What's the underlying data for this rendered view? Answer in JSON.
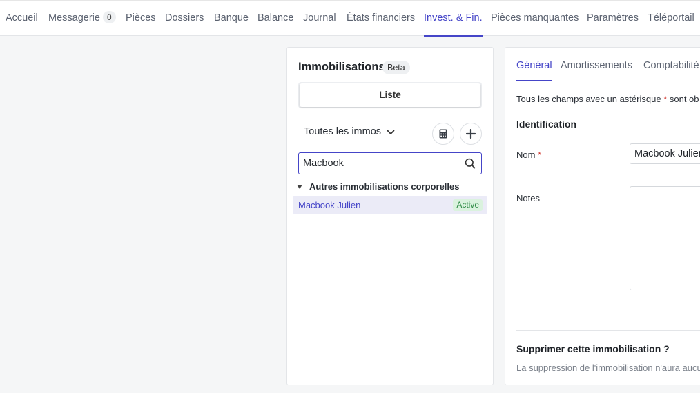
{
  "nav": {
    "items": [
      {
        "label": "Accueil"
      },
      {
        "label": "Messagerie",
        "badge": "0"
      },
      {
        "label": "Pièces"
      },
      {
        "label": "Dossiers"
      },
      {
        "label": "Banque"
      },
      {
        "label": "Balance"
      },
      {
        "label": "Journal"
      },
      {
        "label": "États financiers"
      },
      {
        "label": "Invest. & Fin.",
        "active": true
      },
      {
        "label": "Pièces manquantes"
      },
      {
        "label": "Paramètres"
      },
      {
        "label": "Téléportail"
      }
    ]
  },
  "list_panel": {
    "title": "Immobilisations",
    "beta_badge": "Beta",
    "tab_label": "Liste",
    "filter": {
      "selected": "Toutes les immos"
    },
    "calculator_icon": "calculator-icon",
    "add_icon": "plus-icon",
    "search": {
      "value": "Macbook",
      "icon": "search-icon"
    },
    "group": {
      "label": "Autres immobilisations corporelles",
      "items": [
        {
          "label": "Macbook Julien",
          "status": "Active"
        }
      ]
    }
  },
  "detail_panel": {
    "tabs": [
      {
        "label": "Général",
        "active": true
      },
      {
        "label": "Amortissements"
      },
      {
        "label": "Comptabilité"
      }
    ],
    "required_note_prefix": "Tous les champs avec un astérisque",
    "required_note_asterisk": "*",
    "required_note_suffix": "sont ob",
    "section_title": "Identification",
    "name_label": "Nom",
    "required_mark": "*",
    "name_value": "Macbook Julien",
    "notes_label": "Notes",
    "notes_value": "",
    "delete_title": "Supprimer cette immobilisation ?",
    "delete_description": "La suppression de l'immobilisation n'aura aucu"
  },
  "colors": {
    "accent": "#4545c8",
    "active_badge_bg": "#daf2de",
    "active_badge_text": "#2e8b45",
    "required": "#d0342c"
  }
}
